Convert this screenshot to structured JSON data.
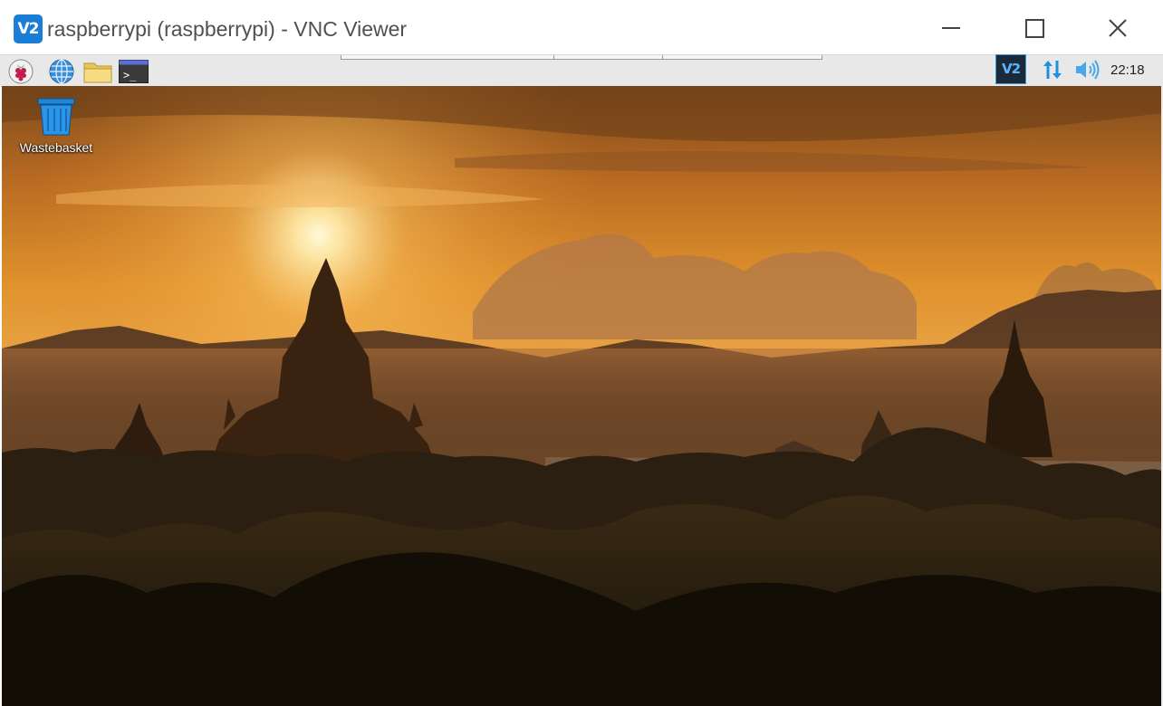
{
  "window": {
    "app_icon": "vnc-viewer-icon",
    "app_icon_text": "V2",
    "title": "raspberrypi (raspberrypi) - VNC Viewer"
  },
  "taskbar": {
    "left_icons": [
      "raspberry-pi-menu-icon",
      "web-browser-icon",
      "file-manager-icon",
      "terminal-icon"
    ],
    "terminal_prompt": ">_",
    "tray_icons": [
      "vnc-server-icon",
      "network-icon",
      "volume-icon"
    ],
    "vnc_tray_text": "V2",
    "clock": "22:18"
  },
  "desktop": {
    "wallpaper": "sunset-over-bagan-temples",
    "icons": [
      {
        "label": "Wastebasket",
        "icon": "wastebasket-icon"
      }
    ]
  },
  "colors": {
    "vnc_blue": "#1a7dd6",
    "taskbar_bg": "#e8e8e8",
    "sun_glow": "#ffe9a6",
    "sky_orange": "#e0922c"
  }
}
